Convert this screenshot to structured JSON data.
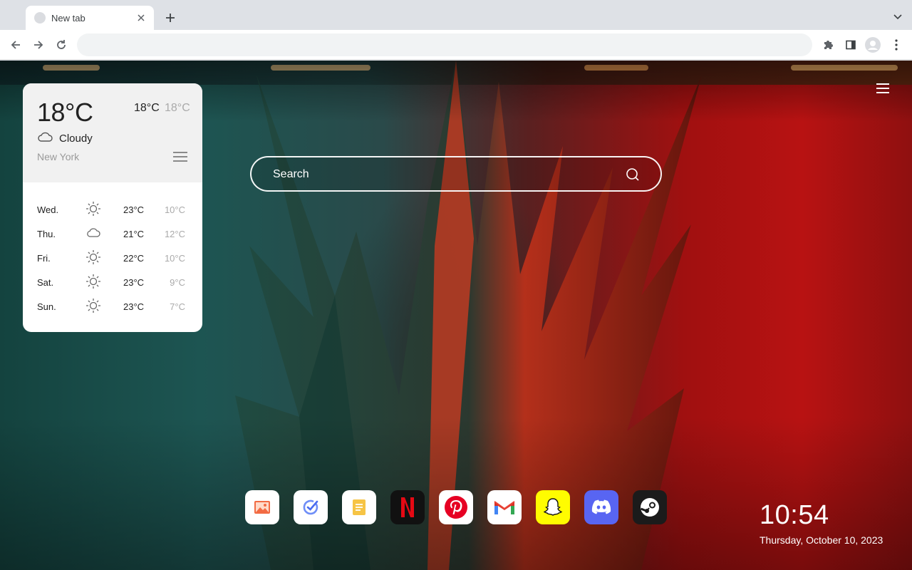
{
  "browser": {
    "tab": {
      "title": "New tab"
    },
    "omnibox": {
      "value": "",
      "placeholder": ""
    }
  },
  "weather": {
    "current_temp": "18°C",
    "high": "18°C",
    "low": "18°C",
    "condition": "Cloudy",
    "city": "New York",
    "forecast": [
      {
        "day": "Wed.",
        "icon": "sun-icon",
        "high": "23°C",
        "low": "10°C"
      },
      {
        "day": "Thu.",
        "icon": "cloud-icon",
        "high": "21°C",
        "low": "12°C"
      },
      {
        "day": "Fri.",
        "icon": "sun-icon",
        "high": "22°C",
        "low": "10°C"
      },
      {
        "day": "Sat.",
        "icon": "sun-icon",
        "high": "23°C",
        "low": "9°C"
      },
      {
        "day": "Sun.",
        "icon": "sun-icon",
        "high": "23°C",
        "low": "7°C"
      }
    ]
  },
  "search": {
    "placeholder": "Search"
  },
  "dock": {
    "apps": [
      {
        "name": "photos",
        "icon": "photo-icon",
        "bg": "#ffffff"
      },
      {
        "name": "tasks",
        "icon": "check-icon",
        "bg": "#ffffff"
      },
      {
        "name": "notes",
        "icon": "note-icon",
        "bg": "#ffffff"
      },
      {
        "name": "netflix",
        "icon": "netflix-icon",
        "bg": "#111111"
      },
      {
        "name": "pinterest",
        "icon": "pinterest-icon",
        "bg": "#ffffff"
      },
      {
        "name": "gmail",
        "icon": "gmail-icon",
        "bg": "#ffffff"
      },
      {
        "name": "snapchat",
        "icon": "snapchat-icon",
        "bg": "#fffc00"
      },
      {
        "name": "discord",
        "icon": "discord-icon",
        "bg": "#5865f2"
      },
      {
        "name": "steam",
        "icon": "steam-icon",
        "bg": "#1b1b1b"
      }
    ]
  },
  "clock": {
    "time": "10:54",
    "date": "Thursday, October 10, 2023"
  },
  "colors": {
    "netflix_red": "#e50914",
    "pinterest_red": "#e60023",
    "discord_blue": "#5865f2",
    "snap_yellow": "#fffc00"
  }
}
